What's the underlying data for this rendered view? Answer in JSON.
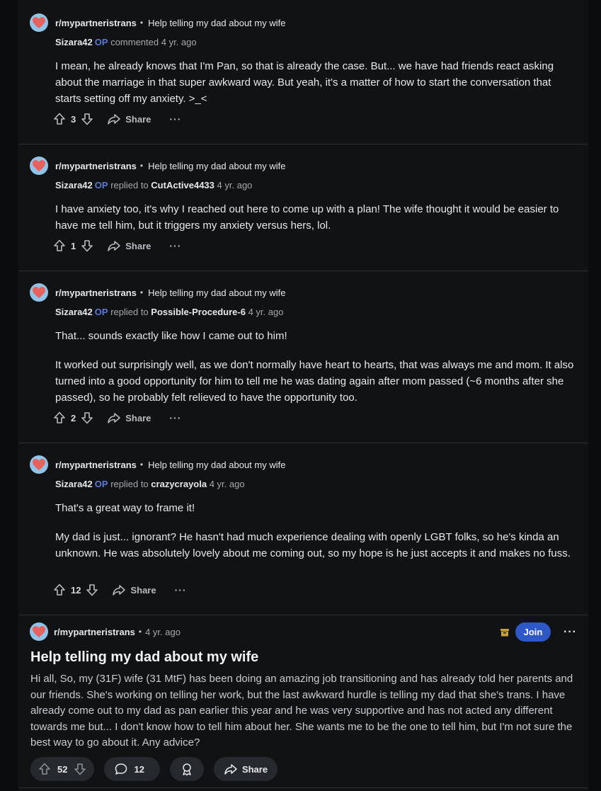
{
  "comments": [
    {
      "subreddit": "r/mypartneristrans",
      "post_title": "Help telling my dad about my wife",
      "author": "Sizara42",
      "op_badge": "OP",
      "action": "commented",
      "reply_to": "",
      "time": "4 yr. ago",
      "paragraphs": [
        "I mean, he already knows that I'm Pan, so that is already the case. But... we have had friends react asking about the marriage in that super awkward way. But yeah, it's a matter of how to start the conversation that starts setting off my anxiety. >_<"
      ],
      "votes": "3",
      "share_label": "Share",
      "more_label": "···"
    },
    {
      "subreddit": "r/mypartneristrans",
      "post_title": "Help telling my dad about my wife",
      "author": "Sizara42",
      "op_badge": "OP",
      "action": "replied to",
      "reply_to": "CutActive4433",
      "time": "4 yr. ago",
      "paragraphs": [
        "I have anxiety too, it's why I reached out here to come up with a plan! The wife thought it would be easier to have me tell him, but it triggers my anxiety versus hers, lol."
      ],
      "votes": "1",
      "share_label": "Share",
      "more_label": "···"
    },
    {
      "subreddit": "r/mypartneristrans",
      "post_title": "Help telling my dad about my wife",
      "author": "Sizara42",
      "op_badge": "OP",
      "action": "replied to",
      "reply_to": "Possible-Procedure-6",
      "time": "4 yr. ago",
      "paragraphs": [
        "That... sounds exactly like how I came out to him!",
        "It worked out surprisingly well, as we don't normally have heart to hearts, that was always me and mom. It also turned into a good opportunity for him to tell me he was dating again after mom passed (~6 months after she passed), so he probably felt relieved to have the opportunity too."
      ],
      "votes": "2",
      "share_label": "Share",
      "more_label": "···"
    },
    {
      "subreddit": "r/mypartneristrans",
      "post_title": "Help telling my dad about my wife",
      "author": "Sizara42",
      "op_badge": "OP",
      "action": "replied to",
      "reply_to": "crazycrayola",
      "time": "4 yr. ago",
      "paragraphs": [
        "That's a great way to frame it!",
        "My dad is just... ignorant? He hasn't had much experience dealing with openly LGBT folks, so he's kinda an unknown. He was absolutely lovely about me coming out, so my hope is he just accepts it and makes no fuss."
      ],
      "votes": "12",
      "share_label": "Share",
      "more_label": "···"
    }
  ],
  "post": {
    "subreddit": "r/mypartneristrans",
    "time": "4 yr. ago",
    "join_label": "Join",
    "more_label": "···",
    "title": "Help telling my dad about my wife",
    "body": "Hi all, So, my (31F) wife (31 MtF) has been doing an amazing job transitioning and has already told her parents and our friends. She's working on telling her work, but the last awkward hurdle is telling my dad that she's trans. I have already come out to my dad as pan earlier this year and he was very supportive and has not acted any different towards me but... I don't know how to tell him about her. She wants me to be the one to tell him, but I'm not sure the best way to go about it. Any advice?",
    "votes": "52",
    "comments": "12",
    "share_label": "Share"
  },
  "icons": {
    "upvote": "arrow-up-outline-icon",
    "downvote": "arrow-down-outline-icon",
    "share": "share-arrow-icon",
    "more": "ellipsis-icon",
    "comment": "speech-bubble-icon",
    "award": "award-icon",
    "archived": "archive-icon",
    "avatar": "heart-avatar-icon"
  },
  "colors": {
    "background": "#0b0c0d",
    "card": "#101214",
    "op_badge": "#5a79d6",
    "join_button": "#2e58c8",
    "avatar_bg": "#8fc4e8",
    "avatar_heart": "#e8625d",
    "archived_icon": "#c8a03a"
  }
}
